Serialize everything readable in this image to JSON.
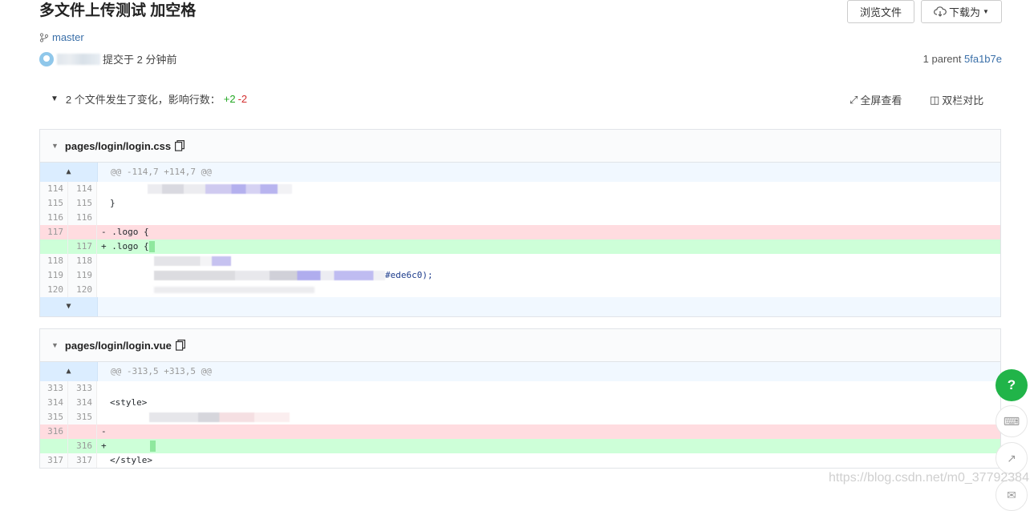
{
  "page": {
    "title": "多文件上传测试 加空格"
  },
  "header": {
    "browse_label": "浏览文件",
    "download_label": "下载为"
  },
  "branch": {
    "name": "master"
  },
  "commit": {
    "text": "提交于 2 分钟前",
    "parent_label": "1 parent",
    "parent_sha": "5fa1b7e"
  },
  "summary": {
    "text": "2 个文件发生了变化，影响行数：",
    "additions": "+2",
    "deletions": "-2"
  },
  "tools": {
    "fullscreen_label": "全屏查看",
    "split_label": "双栏对比"
  },
  "files": [
    {
      "path": "pages/login/login.css",
      "hunk": "@@ -114,7 +114,7 @@",
      "rows": [
        {
          "old": "114",
          "new": "114",
          "type": "ctx",
          "text": ""
        },
        {
          "old": "115",
          "new": "115",
          "type": "ctx",
          "text": "}"
        },
        {
          "old": "116",
          "new": "116",
          "type": "ctx",
          "text": ""
        },
        {
          "old": "117",
          "new": "",
          "type": "del",
          "text": "- .logo {"
        },
        {
          "old": "",
          "new": "117",
          "type": "add",
          "text": "+ .logo {"
        },
        {
          "old": "118",
          "new": "118",
          "type": "ctx",
          "text": ""
        },
        {
          "old": "119",
          "new": "119",
          "type": "ctx",
          "text": "#ede6c0);"
        },
        {
          "old": "120",
          "new": "120",
          "type": "ctx",
          "text": ""
        }
      ]
    },
    {
      "path": "pages/login/login.vue",
      "hunk": "@@ -313,5 +313,5 @@",
      "rows": [
        {
          "old": "313",
          "new": "313",
          "type": "ctx",
          "text": ""
        },
        {
          "old": "314",
          "new": "314",
          "type": "ctx",
          "text": "<style>"
        },
        {
          "old": "315",
          "new": "315",
          "type": "ctx",
          "text": ""
        },
        {
          "old": "316",
          "new": "",
          "type": "del",
          "text": "-"
        },
        {
          "old": "",
          "new": "316",
          "type": "add",
          "text": "+"
        },
        {
          "old": "317",
          "new": "317",
          "type": "ctx",
          "text": "</style>"
        }
      ]
    }
  ],
  "fab": {
    "help_label": "?"
  },
  "watermark": "https://blog.csdn.net/m0_37792384",
  "colors": {
    "add_bg": "#cdffd8",
    "del_bg": "#ffdce0",
    "hunk_bg": "#f1f8ff",
    "help_green": "#21b449",
    "link_blue": "#3a6fa8"
  }
}
